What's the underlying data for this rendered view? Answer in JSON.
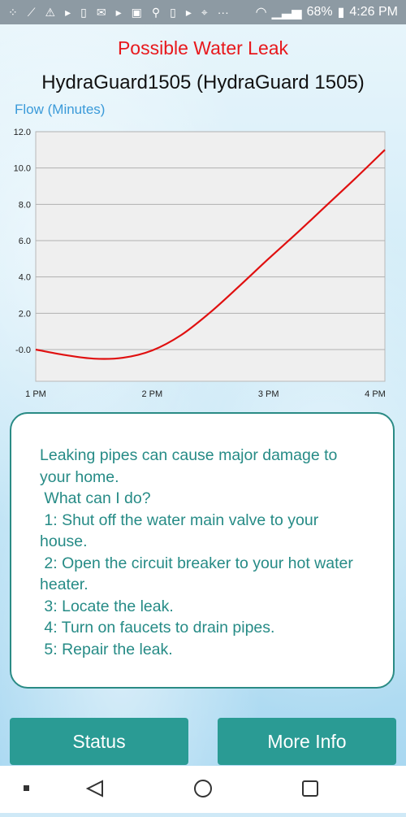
{
  "status_bar": {
    "battery": "68%",
    "time": "4:26 PM",
    "icons": [
      "network-icon",
      "wand-icon",
      "warning-icon",
      "play-icon",
      "sim-icon",
      "mail-icon",
      "play-icon",
      "image-icon",
      "usb-icon",
      "phone-icon",
      "play-icon",
      "location-icon",
      "more-icon",
      "wifi-icon",
      "signal-icon",
      "battery-icon"
    ]
  },
  "header": {
    "alert": "Possible Water Leak",
    "device": "HydraGuard1505 (HydraGuard 1505)"
  },
  "chart_caption": "Flow (Minutes)",
  "chart_data": {
    "type": "line",
    "title": "",
    "xlabel": "",
    "ylabel": "Flow (Minutes)",
    "x_ticks": [
      "1 PM",
      "2 PM",
      "3 PM",
      "4 PM"
    ],
    "y_ticks": [
      "12.0",
      "10.0",
      "8.0",
      "6.0",
      "4.0",
      "2.0",
      "-0.0"
    ],
    "ylim": [
      -1.2,
      12.0
    ],
    "xlim": [
      13.0,
      16.0
    ],
    "grid": true,
    "series": [
      {
        "color": "#e01010",
        "x": [
          13.0,
          13.25,
          13.5,
          13.75,
          14.0,
          14.25,
          14.5,
          14.75,
          15.0,
          15.25,
          15.5,
          15.75,
          16.0
        ],
        "y": [
          0.0,
          -0.3,
          -0.5,
          -0.45,
          -0.05,
          0.8,
          2.05,
          3.5,
          5.0,
          6.45,
          7.95,
          9.45,
          11.0
        ]
      }
    ]
  },
  "info": {
    "lines": [
      "Leaking pipes can cause major damage to your home.",
      " What can I do?",
      " 1: Shut off the water main valve to your house.",
      " 2: Open the circuit breaker to your hot water heater.",
      " 3: Locate the leak.",
      " 4: Turn on faucets to drain pipes.",
      " 5: Repair the leak."
    ]
  },
  "buttons": {
    "status": "Status",
    "more_info": "More Info"
  }
}
